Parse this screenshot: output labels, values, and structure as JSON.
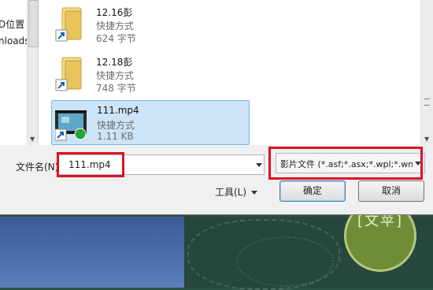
{
  "nav": {
    "items": [
      "D位置",
      "nloads"
    ]
  },
  "files": [
    {
      "name": "12.16彭",
      "type": "快捷方式",
      "size": "624 字节",
      "selected": false
    },
    {
      "name": "12.18彭",
      "type": "快捷方式",
      "size": "748 字节",
      "selected": false
    },
    {
      "name": "111.mp4",
      "type": "快捷方式",
      "size": "1.11 KB",
      "selected": true
    }
  ],
  "filename": {
    "label": "文件名(N):",
    "value": "111.mp4"
  },
  "filter": {
    "value": "影片文件 (*.asf;*.asx;*.wpl;*.wm"
  },
  "buttons": {
    "tools": "工具(L)",
    "ok": "确定",
    "cancel": "取消"
  },
  "background": {
    "badge_text": "[文苹]"
  },
  "colors": {
    "highlight": "#e01025",
    "selection": "#cce4f7",
    "folder": "#e8c45a"
  }
}
